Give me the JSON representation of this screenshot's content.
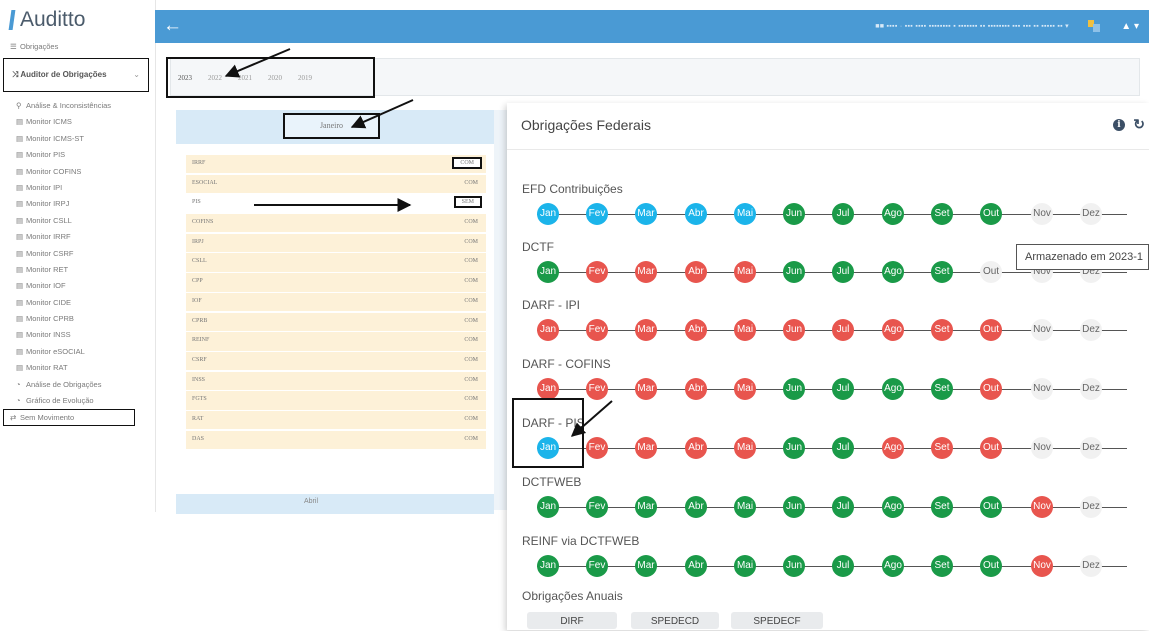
{
  "app": {
    "name": "Auditto"
  },
  "topbar": {
    "back_icon": "arrow-left-icon",
    "user_text": "■■ ▪▪▪▪ · ▪▪▪ ▪▪▪▪ ▪▪▪▪▪▪▪▪ ▪ ▪▪▪▪▪▪▪ ▪▪ ▪▪▪▪▪▪▪▪ ▪▪▪ ▪▪▪ ▪▪ ▪▪▪▪▪ ▪▪ ▾",
    "user_caret": "▲ ▾"
  },
  "sidebar": {
    "top_item": "Obrigações",
    "group": "Auditor de Obrigações",
    "items": [
      "Análise & Inconsistências",
      "Monitor ICMS",
      "Monitor ICMS-ST",
      "Monitor PIS",
      "Monitor COFINS",
      "Monitor IPI",
      "Monitor IRPJ",
      "Monitor CSLL",
      "Monitor IRRF",
      "Monitor CSRF",
      "Monitor RET",
      "Monitor IOF",
      "Monitor CIDE",
      "Monitor CPRB",
      "Monitor INSS",
      "Monitor eSOCIAL",
      "Monitor RAT",
      "Análise de Obrigações",
      "Gráfico de Evolução",
      "Sem Movimento"
    ]
  },
  "years": [
    "2023",
    "2022",
    "2021",
    "2020",
    "2019"
  ],
  "month_panel": {
    "month": "Janeiro",
    "rows": [
      {
        "label": "IRRF",
        "status": "COM"
      },
      {
        "label": "ESOCIAL",
        "status": "COM"
      },
      {
        "label": "PIS",
        "status": "SEM"
      },
      {
        "label": "COFINS",
        "status": "COM"
      },
      {
        "label": "IRPJ",
        "status": "COM"
      },
      {
        "label": "CSLL",
        "status": "COM"
      },
      {
        "label": "CPP",
        "status": "COM"
      },
      {
        "label": "IOF",
        "status": "COM"
      },
      {
        "label": "CPRB",
        "status": "COM"
      },
      {
        "label": "REINF",
        "status": "COM"
      },
      {
        "label": "CSRF",
        "status": "COM"
      },
      {
        "label": "INSS",
        "status": "COM"
      },
      {
        "label": "FGTS",
        "status": "COM"
      },
      {
        "label": "RAT",
        "status": "COM"
      },
      {
        "label": "DAS",
        "status": "COM"
      }
    ],
    "footer": "Abril"
  },
  "popup": {
    "title": "Obrigações Federais",
    "info_icon": "info-icon",
    "refresh_icon": "refresh-icon",
    "obligations": [
      {
        "name": "EFD Contribuições",
        "statuses": [
          "blue",
          "blue",
          "blue",
          "blue",
          "blue",
          "green",
          "green",
          "green",
          "green",
          "green",
          "grey",
          "grey"
        ]
      },
      {
        "name": "DCTF",
        "statuses": [
          "green",
          "red",
          "red",
          "red",
          "red",
          "green",
          "green",
          "green",
          "green",
          "grey",
          "grey",
          "grey"
        ]
      },
      {
        "name": "DARF - IPI",
        "statuses": [
          "red",
          "red",
          "red",
          "red",
          "red",
          "red",
          "red",
          "red",
          "red",
          "red",
          "grey",
          "grey"
        ]
      },
      {
        "name": "DARF - COFINS",
        "statuses": [
          "red",
          "red",
          "red",
          "red",
          "red",
          "green",
          "green",
          "green",
          "green",
          "red",
          "grey",
          "grey"
        ]
      },
      {
        "name": "DARF - PIS",
        "statuses": [
          "blue",
          "red",
          "red",
          "red",
          "red",
          "green",
          "green",
          "red",
          "red",
          "red",
          "grey",
          "grey"
        ]
      },
      {
        "name": "DCTFWEB",
        "statuses": [
          "green",
          "green",
          "green",
          "green",
          "green",
          "green",
          "green",
          "green",
          "green",
          "green",
          "red",
          "grey"
        ]
      },
      {
        "name": "REINF via DCTFWEB",
        "statuses": [
          "green",
          "green",
          "green",
          "green",
          "green",
          "green",
          "green",
          "green",
          "green",
          "green",
          "red",
          "grey"
        ]
      }
    ],
    "months": [
      "Jan",
      "Fev",
      "Mar",
      "Abr",
      "Mai",
      "Jun",
      "Jul",
      "Ago",
      "Set",
      "Out",
      "Nov",
      "Dez"
    ],
    "tooltip": "Armazenado em 2023-1",
    "annual_label": "Obrigações Anuais",
    "annual_buttons": [
      "DIRF",
      "SPEDECD",
      "SPEDECF"
    ]
  },
  "colors": {
    "blue": "#1bb4ea",
    "green": "#1a9a48",
    "red": "#e8554e",
    "grey": "#f1f1f1",
    "topbar": "#4a9ad4"
  }
}
